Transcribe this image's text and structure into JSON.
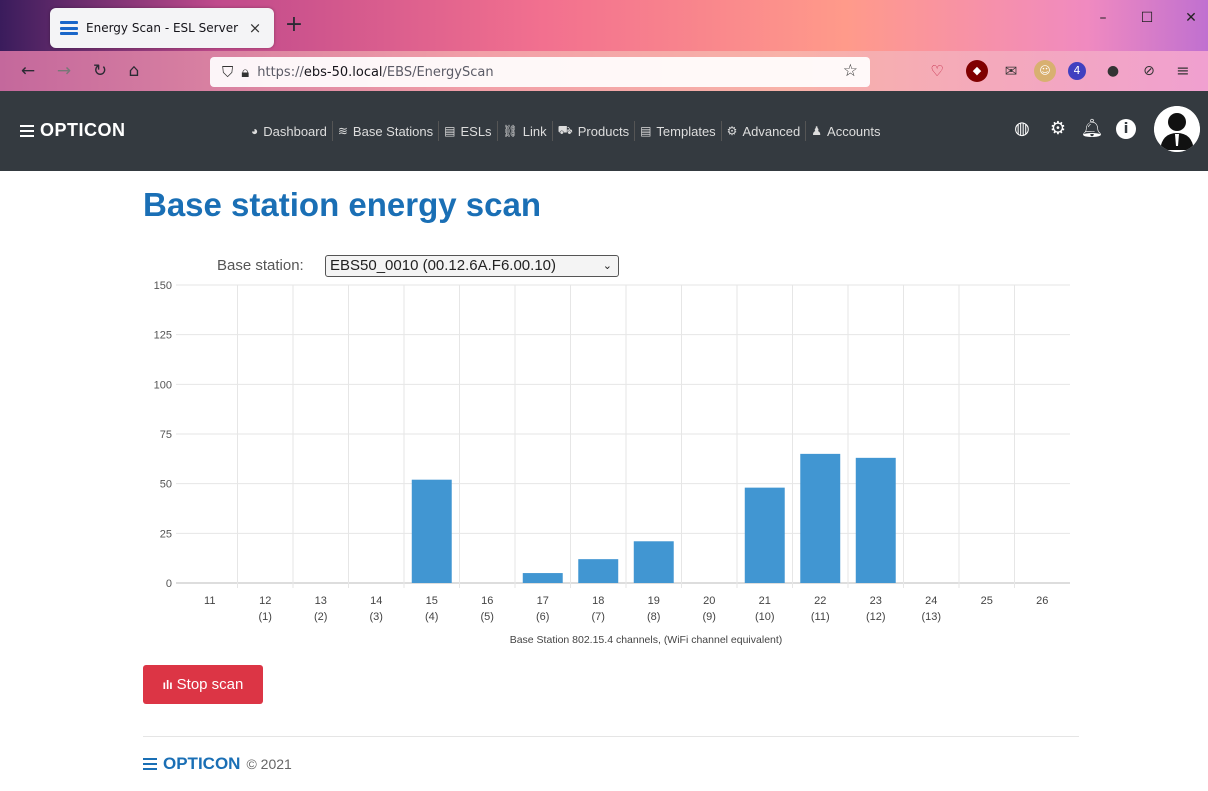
{
  "browser": {
    "tab_title": "Energy Scan - ESL Server",
    "tab_close": "×",
    "new_tab": "+",
    "url_prefix": "https://",
    "url_host": "ebs-50.local",
    "url_path": "/EBS/EnergyScan",
    "ext_badge": "4"
  },
  "app": {
    "brand": "OPTICON",
    "menu": [
      {
        "label": "Dashboard",
        "icon": "dashboard-icon"
      },
      {
        "label": "Base Stations",
        "icon": "wifi-icon"
      },
      {
        "label": "ESLs",
        "icon": "label-icon"
      },
      {
        "label": "Link",
        "icon": "link-icon"
      },
      {
        "label": "Products",
        "icon": "cart-icon"
      },
      {
        "label": "Templates",
        "icon": "template-icon"
      },
      {
        "label": "Advanced",
        "icon": "gears-icon"
      },
      {
        "label": "Accounts",
        "icon": "user-icon"
      }
    ]
  },
  "page": {
    "title": "Base station energy scan",
    "base_station_label": "Base station:",
    "base_station_value": "EBS50_0010 (00.12.6A.F6.00.10)",
    "stop_button": "Stop scan"
  },
  "footer": {
    "brand": "OPTICON",
    "copyright": "© 2021"
  },
  "colors": {
    "bar": "#4196d2",
    "accent": "#1a6fb5",
    "danger": "#dc3545",
    "navbar": "#343a40"
  },
  "chart_data": {
    "type": "bar",
    "categories": [
      "11",
      "12",
      "13",
      "14",
      "15",
      "16",
      "17",
      "18",
      "19",
      "20",
      "21",
      "22",
      "23",
      "24",
      "25",
      "26"
    ],
    "subcategories": [
      "",
      "(1)",
      "(2)",
      "(3)",
      "(4)",
      "(5)",
      "(6)",
      "(7)",
      "(8)",
      "(9)",
      "(10)",
      "(11)",
      "(12)",
      "(13)",
      "",
      ""
    ],
    "values": [
      0,
      0,
      0,
      0,
      52,
      0,
      5,
      12,
      21,
      0,
      48,
      65,
      63,
      0,
      0,
      0
    ],
    "xlabel": "Base Station 802.15.4 channels, (WiFi channel equivalent)",
    "ylabel": "",
    "ylim": [
      0,
      150
    ],
    "yticks": [
      0,
      25,
      50,
      75,
      100,
      125,
      150
    ],
    "grid": true
  }
}
